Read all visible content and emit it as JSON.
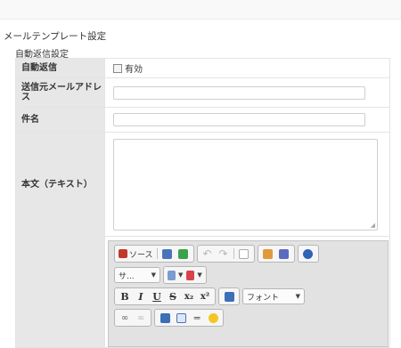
{
  "page": {
    "title": "メールテンプレート設定",
    "section": "自動返信設定"
  },
  "form": {
    "auto_reply": {
      "label": "自動返信",
      "checkbox_label": "有効",
      "checked": false
    },
    "from_address": {
      "label": "送信元メールアドレス",
      "value": ""
    },
    "subject": {
      "label": "件名",
      "value": ""
    },
    "body_text": {
      "label": "本文（テキスト）",
      "value": ""
    }
  },
  "editor": {
    "source_label": "ソース",
    "format_combo": "サ...",
    "font_combo": "フォント",
    "buttons": {
      "bold": "B",
      "italic": "I",
      "underline": "U",
      "strike": "S",
      "subscript": "x₂",
      "superscript": "x²"
    },
    "icons": [
      "source-icon",
      "save-icon",
      "maximize-icon",
      "undo-icon",
      "redo-icon",
      "new-page-icon",
      "preview-icon",
      "template-icon",
      "about-icon",
      "bulleted-list-icon",
      "table-icon",
      "image-icon",
      "link-icon",
      "unlink-icon",
      "insert-icon",
      "grid-icon",
      "horizontal-rule-icon",
      "smiley-icon"
    ]
  },
  "colors": {
    "label_bg": "#e7e7e7",
    "editor_bg": "#e2e2e2",
    "accent": "#3b6fb6"
  }
}
